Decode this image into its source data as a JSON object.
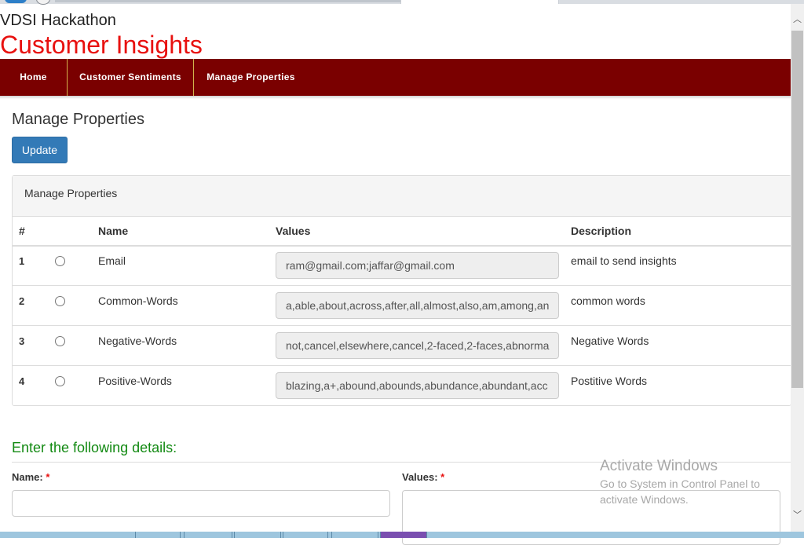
{
  "app": {
    "name": "VDSI Hackathon",
    "title": "Customer Insights"
  },
  "nav": {
    "items": [
      {
        "label": "Home"
      },
      {
        "label": "Customer Sentiments"
      },
      {
        "label": "Manage Properties"
      }
    ]
  },
  "page": {
    "heading": "Manage Properties",
    "update_label": "Update"
  },
  "panel": {
    "title": "Manage Properties",
    "columns": [
      "#",
      "Name",
      "Values",
      "Description"
    ],
    "rows": [
      {
        "num": "1",
        "name": "Email",
        "value": "ram@gmail.com;jaffar@gmail.com",
        "description": "email to send insights"
      },
      {
        "num": "2",
        "name": "Common-Words",
        "value": "a,able,about,across,after,all,almost,also,am,among,an",
        "description": "common words"
      },
      {
        "num": "3",
        "name": "Negative-Words",
        "value": "not,cancel,elsewhere,cancel,2-faced,2-faces,abnorma",
        "description": "Negative Words"
      },
      {
        "num": "4",
        "name": "Positive-Words",
        "value": "blazing,a+,abound,abounds,abundance,abundant,acc",
        "description": "Postitive Words"
      }
    ]
  },
  "form": {
    "title": "Enter the following details:",
    "name_label": "Name:",
    "values_label": "Values:",
    "required_mark": "*"
  },
  "watermark": {
    "line1": "Activate Windows",
    "line2": "Go to System in Control Panel to",
    "line3": "activate Windows."
  },
  "scroll": {
    "up_arrow": "︿",
    "down_arrow": "﹀"
  },
  "colors": {
    "brand_red": "#e8110f",
    "nav_bg": "#7a0000",
    "primary_button": "#337ab7",
    "section_green": "#138a13"
  }
}
